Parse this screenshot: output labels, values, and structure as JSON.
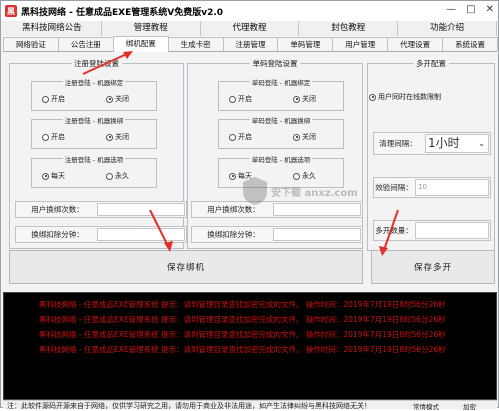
{
  "window": {
    "title": "黑科技网络 - 任意成品EXE管理系统V免费版v2.0",
    "min_glyph": "—",
    "max_glyph": "□",
    "close_glyph": "✕"
  },
  "topmenu": [
    "黑科技网络公告",
    "管理教程",
    "代理教程",
    "封包教程",
    "功能介绍"
  ],
  "subtabs": [
    "网络验证",
    "公告注册",
    "绑机配置",
    "生成卡密",
    "注册管理",
    "单码管理",
    "用户管理",
    "代理设置",
    "系统设置"
  ],
  "left_group": {
    "title": "注册登陆设置",
    "bind": {
      "title": "注册登陆 - 机器绑定",
      "opt1": "开启",
      "opt2": "关闭",
      "selected": "关闭"
    },
    "unbind": {
      "title": "注册登陆 - 机器换绑",
      "opt1": "开启",
      "opt2": "关闭",
      "selected": "关闭"
    },
    "options": {
      "title": "注册登陆 - 机器选项",
      "opt1": "每天",
      "opt2": "永久",
      "selected": "每天"
    },
    "rebind_count_label": "用户换绑次数：",
    "rebind_deduct_label": "换绑扣除分钟："
  },
  "mid_group": {
    "title": "单码登陆设置",
    "bind": {
      "title": "单码登陆 - 机器绑定",
      "opt1": "开启",
      "opt2": "关闭",
      "selected": "关闭"
    },
    "unbind": {
      "title": "单码登陆 - 机器换绑",
      "opt1": "开启",
      "opt2": "关闭",
      "selected": "关闭"
    },
    "options": {
      "title": "单码登陆 - 机器选项",
      "opt1": "每天",
      "opt2": "永久",
      "selected": "每天"
    },
    "rebind_count_label": "用户换绑次数：",
    "rebind_deduct_label": "换绑扣除分钟："
  },
  "save_bind_label": "保存绑机",
  "right_group": {
    "title": "多开配置",
    "checkbox_label": "用户同时在线数限制",
    "cleanup_label": "清理间隔：",
    "cleanup_value": "1小时",
    "check_interval_label": "效验间隔：",
    "check_interval_value": "10",
    "open_count_label": "多开数量：",
    "save_label": "保存多开"
  },
  "log_rows": [
    "黑科技网络 - 任意成品EXE管理系统  提示：请到管理目录查找加密完成的文件。   操作时间：2019年7月19日8时56分26秒",
    "黑科技网络 - 任意成品EXE管理系统  提示：请到管理目录查找加密完成的文件。   操作时间：2019年7月19日8时56分26秒",
    "黑科技网络 - 任意成品EXE管理系统  提示：请到管理目录查找加密完成的文件。   操作时间：2019年7月19日8时56分26秒",
    "黑科技网络 - 任意成品EXE管理系统  提示：请到管理目录查找加密完成的文件。   操作时间：2019年7月19日8时56分26秒"
  ],
  "status": {
    "message": "注：此软件源码开源来自于网络，仅供学习研究之用，请勿用于商业及非法用途，如产生法律纠纷与黑科技网络无关！",
    "btn1": "常情模式",
    "btn2": "加密"
  },
  "watermark": "安下载 anxz.com"
}
